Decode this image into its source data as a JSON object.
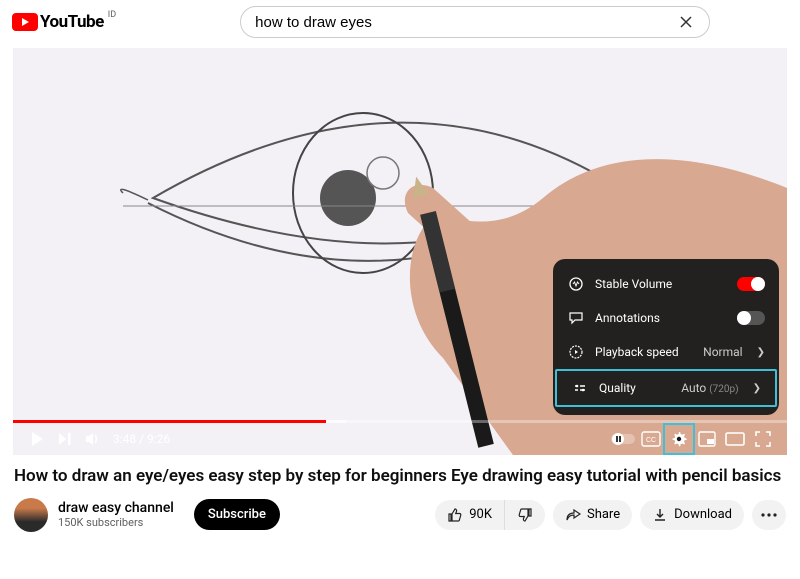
{
  "header": {
    "logo_text": "YouTube",
    "region": "ID",
    "search_value": "how to draw eyes"
  },
  "player": {
    "current_time": "3:48",
    "duration": "9:26"
  },
  "settings": {
    "stable_volume": {
      "label": "Stable Volume",
      "on": true
    },
    "annotations": {
      "label": "Annotations",
      "on": false
    },
    "playback_speed": {
      "label": "Playback speed",
      "value": "Normal"
    },
    "quality": {
      "label": "Quality",
      "value": "Auto",
      "sub": "(720p)"
    }
  },
  "video": {
    "title": "How to draw an eye/eyes easy step by step for beginners Eye drawing easy tutorial with pencil basics"
  },
  "channel": {
    "name": "draw easy channel",
    "subs": "150K subscribers",
    "subscribe_label": "Subscribe"
  },
  "actions": {
    "likes": "90K",
    "share": "Share",
    "download": "Download"
  }
}
